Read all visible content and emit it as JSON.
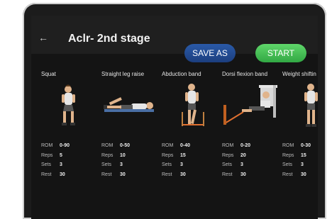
{
  "header": {
    "title": "Aclr- 2nd stage",
    "back_icon": "arrow-left-icon",
    "save_label": "SAVE AS",
    "start_label": "START"
  },
  "labels": {
    "rom": "ROM",
    "reps": "Reps",
    "sets": "Sets",
    "rest": "Rest"
  },
  "exercises": [
    {
      "name": "Squat",
      "rom": "0-90",
      "reps": "5",
      "sets": "3",
      "rest": "30"
    },
    {
      "name": "Straight leg raise",
      "rom": "0-50",
      "reps": "10",
      "sets": "3",
      "rest": "30"
    },
    {
      "name": "Abduction band",
      "rom": "0-40",
      "reps": "15",
      "sets": "3",
      "rest": "30"
    },
    {
      "name": "Dorsi flexion band",
      "rom": "0-20",
      "reps": "20",
      "sets": "3",
      "rest": "30"
    },
    {
      "name": "Weight shiftin",
      "rom": "0-30",
      "reps": "15",
      "sets": "3",
      "rest": "30"
    }
  ],
  "colors": {
    "save_button": "#1f4a96",
    "start_button": "#43c153",
    "background": "#141414"
  }
}
